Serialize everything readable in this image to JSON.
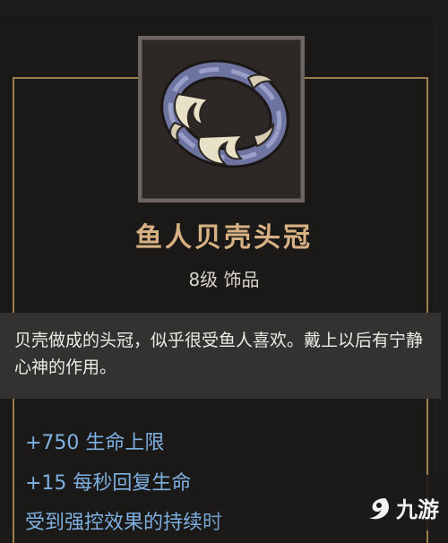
{
  "item": {
    "name": "鱼人贝壳头冠",
    "level_type": "8级 饰品",
    "icon": "shell-crown-icon",
    "description": "贝壳做成的头冠，似乎很受鱼人喜欢。戴上以后有宁静心神的作用。",
    "stats": [
      "+750 生命上限",
      "+15 每秒回复生命",
      "受到强控效果的持续时"
    ]
  },
  "watermark": {
    "text": "九游",
    "logo": "jiuyou-logo-icon"
  },
  "colors": {
    "title": "#d7b183",
    "stat": "#7fb0e2",
    "frame": "#9b7e4c"
  }
}
